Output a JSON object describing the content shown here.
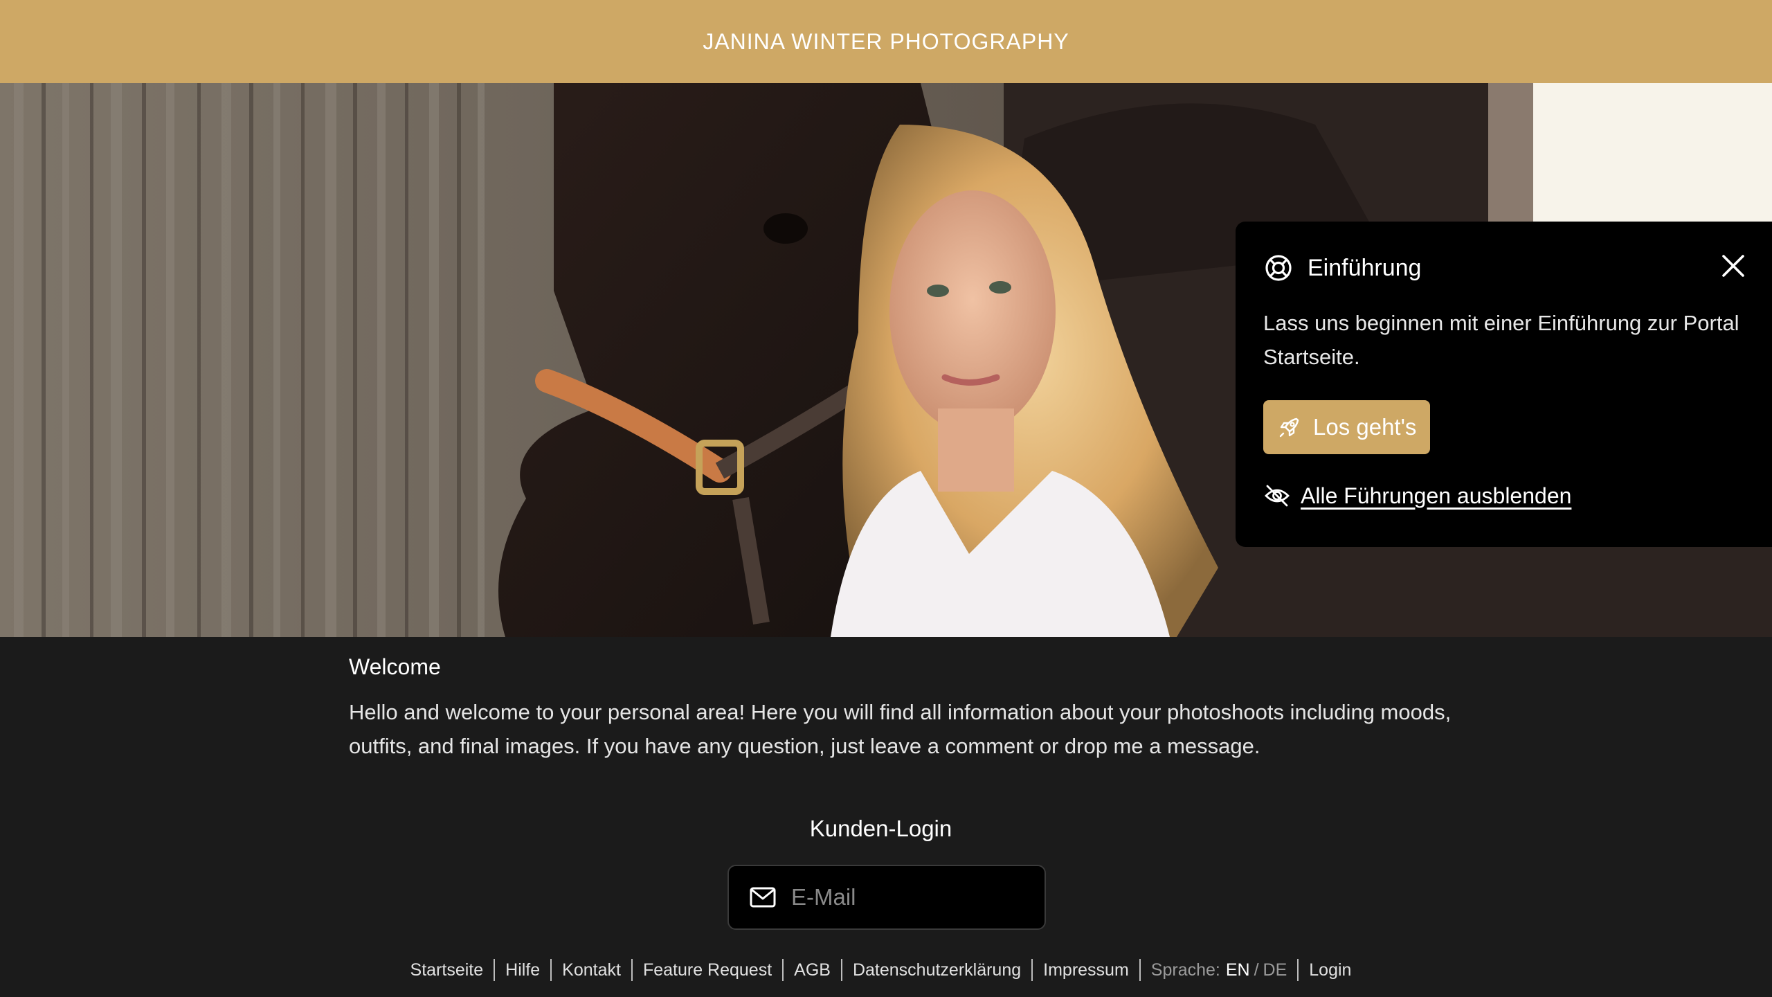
{
  "header": {
    "brand": "JANINA WINTER PHOTOGRAPHY"
  },
  "hero": {
    "alt": "Woman with horse in front of wooden barn wall"
  },
  "tour": {
    "title": "Einführung",
    "text": "Lass uns beginnen mit einer Einführung zur Portal Startseite.",
    "start_label": "Los geht's",
    "hide_label": "Alle Führungen ausblenden",
    "icons": {
      "header": "lifebuoy-icon",
      "start": "rocket-icon",
      "hide": "eye-off-icon",
      "close": "close-icon"
    }
  },
  "welcome": {
    "title": "Welcome",
    "text": "Hello and welcome to your personal area! Here you will find all information about your photoshoots including moods, outfits, and final images. If you have any question, just leave a comment or drop me a message."
  },
  "login": {
    "title": "Kunden-Login",
    "email_placeholder": "E-Mail",
    "email_value": ""
  },
  "footer": {
    "links": [
      "Startseite",
      "Hilfe",
      "Kontakt",
      "Feature Request",
      "AGB",
      "Datenschutzerklärung",
      "Impressum"
    ],
    "language_label": "Sprache:",
    "lang_en": "EN",
    "lang_slash": "/",
    "lang_de": "DE",
    "login": "Login"
  },
  "colors": {
    "accent": "#cea865",
    "background": "#1b1b1b",
    "popup": "#000000"
  }
}
